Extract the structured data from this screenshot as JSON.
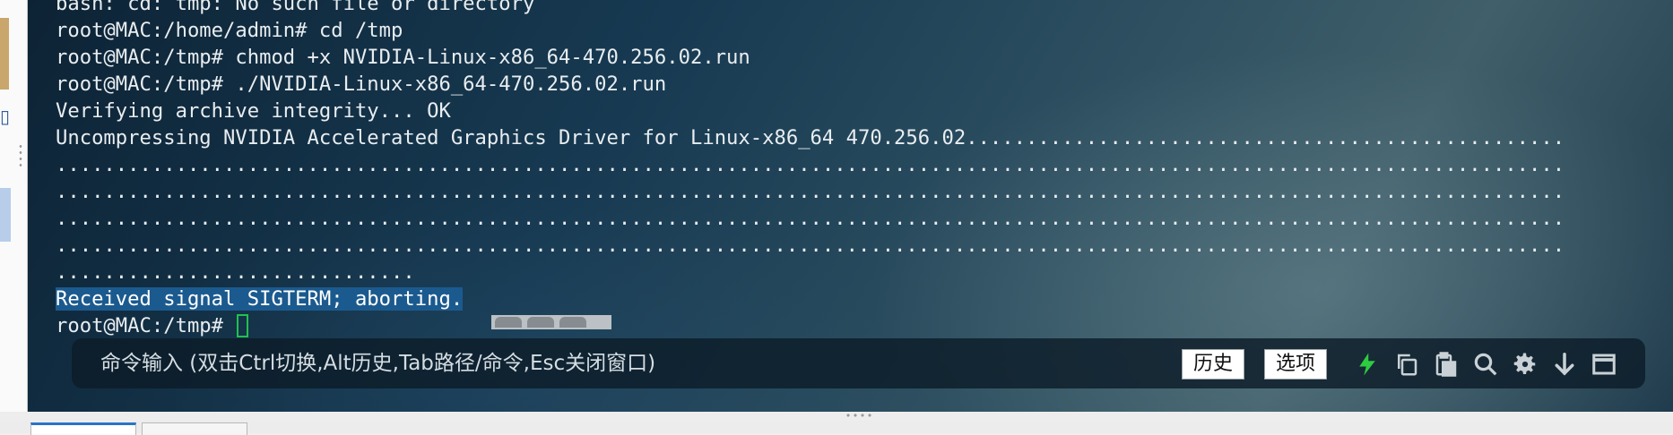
{
  "terminal": {
    "lines": [
      "bash: cd: tmp: No such file or directory",
      "root@MAC:/home/admin# cd /tmp",
      "root@MAC:/tmp# chmod +x NVIDIA-Linux-x86_64-470.256.02.run",
      "root@MAC:/tmp# ./NVIDIA-Linux-x86_64-470.256.02.run",
      "Verifying archive integrity... OK",
      "Uncompressing NVIDIA Accelerated Graphics Driver for Linux-x86_64 470.256.02..................................................",
      "..............................................................................................................................",
      "..............................................................................................................................",
      "..............................................................................................................................",
      "..............................................................................................................................",
      ".............................."
    ],
    "selected_line": "Received signal SIGTERM; aborting.",
    "prompt": "root@MAC:/tmp# "
  },
  "command_bar": {
    "placeholder": "命令输入 (双击Ctrl切换,Alt历史,Tab路径/命令,Esc关闭窗口)",
    "history_label": "历史",
    "options_label": "选项",
    "icons": [
      "lightning-icon",
      "copy-icon",
      "paste-icon",
      "search-icon",
      "gear-icon",
      "download-arrow-icon",
      "window-icon"
    ],
    "accent_color": "#2ecc40"
  },
  "colors": {
    "selection": "#1b5a8e",
    "cursor": "#21c14f",
    "text": "#e8edf0"
  }
}
